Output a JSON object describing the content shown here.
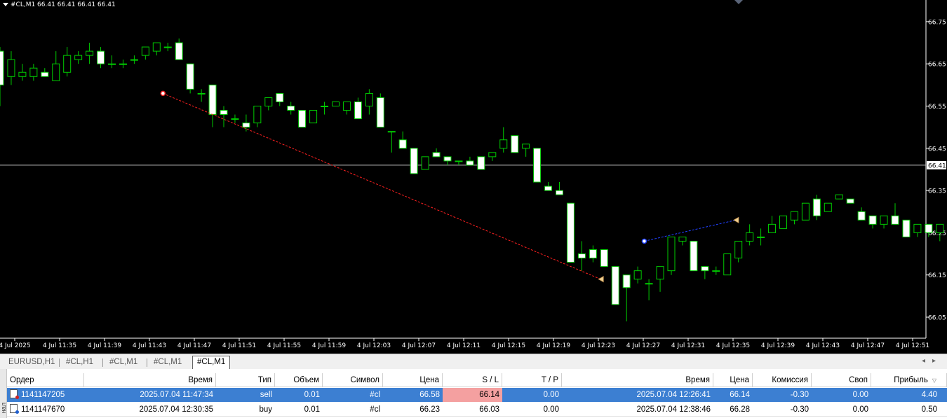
{
  "chart": {
    "header_text": "#CL,M1  66.41 66.41 66.41 66.41",
    "current_price": "66.41",
    "price_axis": [
      "66.75",
      "66.65",
      "66.55",
      "66.45",
      "66.35",
      "66.25",
      "66.15",
      "66.05"
    ],
    "time_axis": [
      "4 Jul 2025",
      "4 Jul 11:35",
      "4 Jul 11:39",
      "4 Jul 11:43",
      "4 Jul 11:47",
      "4 Jul 11:51",
      "4 Jul 11:55",
      "4 Jul 11:59",
      "4 Jul 12:03",
      "4 Jul 12:07",
      "4 Jul 12:11",
      "4 Jul 12:15",
      "4 Jul 12:19",
      "4 Jul 12:23",
      "4 Jul 12:27",
      "4 Jul 12:31",
      "4 Jul 12:35",
      "4 Jul 12:39",
      "4 Jul 12:43",
      "4 Jul 12:47",
      "4 Jul 12:51"
    ],
    "colors": {
      "background": "#000000",
      "bull": "#000000",
      "bear": "#ffffff",
      "wick": "#00cc00",
      "sell_trade_line": "#ff2020",
      "buy_trade_line": "#2040ff",
      "current_line": "#c0c0c0"
    }
  },
  "chart_data": {
    "type": "candlestick",
    "symbol": "#CL",
    "timeframe": "M1",
    "ylim": [
      66.01,
      66.8
    ],
    "candles": [
      [
        66.68,
        66.69,
        66.55,
        66.6
      ],
      [
        66.62,
        66.68,
        66.6,
        66.66
      ],
      [
        66.62,
        66.65,
        66.61,
        66.63
      ],
      [
        66.62,
        66.65,
        66.61,
        66.64
      ],
      [
        66.63,
        66.64,
        66.62,
        66.62
      ],
      [
        66.61,
        66.68,
        66.61,
        66.65
      ],
      [
        66.63,
        66.69,
        66.62,
        66.67
      ],
      [
        66.66,
        66.68,
        66.65,
        66.67
      ],
      [
        66.67,
        66.7,
        66.65,
        66.68
      ],
      [
        66.68,
        66.69,
        66.64,
        66.65
      ],
      [
        66.65,
        66.67,
        66.64,
        66.65
      ],
      [
        66.65,
        66.66,
        66.64,
        66.65
      ],
      [
        66.66,
        66.67,
        66.65,
        66.66
      ],
      [
        66.67,
        66.69,
        66.66,
        66.69
      ],
      [
        66.68,
        66.7,
        66.67,
        66.7
      ],
      [
        66.69,
        66.7,
        66.68,
        66.69
      ],
      [
        66.7,
        66.71,
        66.66,
        66.66
      ],
      [
        66.65,
        66.65,
        66.58,
        66.59
      ],
      [
        66.58,
        66.59,
        66.56,
        66.58
      ],
      [
        66.6,
        66.6,
        66.5,
        66.53
      ],
      [
        66.54,
        66.55,
        66.5,
        66.53
      ],
      [
        66.52,
        66.53,
        66.51,
        66.52
      ],
      [
        66.51,
        66.53,
        66.49,
        66.5
      ],
      [
        66.51,
        66.55,
        66.5,
        66.55
      ],
      [
        66.55,
        66.57,
        66.54,
        66.57
      ],
      [
        66.58,
        66.58,
        66.55,
        66.56
      ],
      [
        66.55,
        66.56,
        66.53,
        66.54
      ],
      [
        66.54,
        66.54,
        66.5,
        66.5
      ],
      [
        66.51,
        66.54,
        66.51,
        66.54
      ],
      [
        66.55,
        66.56,
        66.53,
        66.55
      ],
      [
        66.55,
        66.56,
        66.55,
        66.56
      ],
      [
        66.54,
        66.56,
        66.53,
        66.56
      ],
      [
        66.56,
        66.57,
        66.52,
        66.52
      ],
      [
        66.55,
        66.59,
        66.53,
        66.58
      ],
      [
        66.57,
        66.58,
        66.5,
        66.5
      ],
      [
        66.49,
        66.49,
        66.44,
        66.49
      ],
      [
        66.47,
        66.49,
        66.45,
        66.45
      ],
      [
        66.45,
        66.45,
        66.39,
        66.39
      ],
      [
        66.4,
        66.43,
        66.4,
        66.43
      ],
      [
        66.44,
        66.45,
        66.43,
        66.43
      ],
      [
        66.43,
        66.43,
        66.41,
        66.42
      ],
      [
        66.42,
        66.42,
        66.41,
        66.42
      ],
      [
        66.42,
        66.43,
        66.41,
        66.41
      ],
      [
        66.43,
        66.43,
        66.4,
        66.4
      ],
      [
        66.43,
        66.44,
        66.42,
        66.44
      ],
      [
        66.45,
        66.5,
        66.44,
        66.47
      ],
      [
        66.48,
        66.48,
        66.44,
        66.44
      ],
      [
        66.45,
        66.46,
        66.43,
        66.46
      ],
      [
        66.45,
        66.45,
        66.37,
        66.37
      ],
      [
        66.36,
        66.37,
        66.35,
        66.35
      ],
      [
        66.35,
        66.37,
        66.34,
        66.34
      ],
      [
        66.32,
        66.32,
        66.18,
        66.18
      ],
      [
        66.2,
        66.23,
        66.16,
        66.19
      ],
      [
        66.21,
        66.22,
        66.18,
        66.19
      ],
      [
        66.21,
        66.21,
        66.17,
        66.17
      ],
      [
        66.17,
        66.17,
        66.08,
        66.08
      ],
      [
        66.15,
        66.15,
        66.04,
        66.12
      ],
      [
        66.14,
        66.17,
        66.13,
        66.16
      ],
      [
        66.13,
        66.14,
        66.09,
        66.13
      ],
      [
        66.14,
        66.17,
        66.11,
        66.17
      ],
      [
        66.16,
        66.24,
        66.15,
        66.24
      ],
      [
        66.23,
        66.24,
        66.22,
        66.24
      ],
      [
        66.23,
        66.23,
        66.16,
        66.16
      ],
      [
        66.17,
        66.17,
        66.14,
        66.16
      ],
      [
        66.16,
        66.17,
        66.15,
        66.16
      ],
      [
        66.15,
        66.2,
        66.15,
        66.2
      ],
      [
        66.19,
        66.23,
        66.18,
        66.23
      ],
      [
        66.23,
        66.27,
        66.22,
        66.25
      ],
      [
        66.24,
        66.26,
        66.22,
        66.24
      ],
      [
        66.25,
        66.29,
        66.25,
        66.27
      ],
      [
        66.26,
        66.29,
        66.26,
        66.29
      ],
      [
        66.28,
        66.3,
        66.27,
        66.3
      ],
      [
        66.28,
        66.32,
        66.28,
        66.32
      ],
      [
        66.33,
        66.34,
        66.28,
        66.29
      ],
      [
        66.3,
        66.32,
        66.3,
        66.32
      ],
      [
        66.33,
        66.34,
        66.33,
        66.34
      ],
      [
        66.33,
        66.33,
        66.32,
        66.32
      ],
      [
        66.3,
        66.31,
        66.28,
        66.28
      ],
      [
        66.29,
        66.29,
        66.26,
        66.27
      ],
      [
        66.27,
        66.29,
        66.26,
        66.29
      ],
      [
        66.29,
        66.32,
        66.27,
        66.27
      ],
      [
        66.28,
        66.28,
        66.24,
        66.24
      ],
      [
        66.25,
        66.27,
        66.24,
        66.27
      ],
      [
        66.27,
        66.27,
        66.24,
        66.25
      ],
      [
        66.25,
        66.27,
        66.23,
        66.27
      ],
      [
        66.26,
        66.29,
        66.26,
        66.29
      ]
    ],
    "trades": [
      {
        "type": "sell",
        "open_time": "2025.07.04 11:47:34",
        "open_price": 66.58,
        "close_time": "2025.07.04 12:26:41",
        "close_price": 66.14
      },
      {
        "type": "buy",
        "open_time": "2025.07.04 12:30:35",
        "open_price": 66.23,
        "close_time": "2025.07.04 12:38:46",
        "close_price": 66.28
      }
    ],
    "current_price": 66.41
  },
  "tabs": [
    {
      "label": "EURUSD,H1",
      "active": false
    },
    {
      "label": "#CL,H1",
      "active": false
    },
    {
      "label": "#CL,M1",
      "active": false
    },
    {
      "label": "#CL,M1",
      "active": false
    },
    {
      "label": "#CL,M1",
      "active": true
    }
  ],
  "orders_table": {
    "side_label": "нал",
    "columns": [
      "Ордер",
      "Время",
      "Тип",
      "Объем",
      "Символ",
      "Цена",
      "S / L",
      "T / P",
      "Время",
      "Цена",
      "Комиссия",
      "Своп",
      "Прибыль"
    ],
    "rows": [
      {
        "order": "1141147205",
        "open_time": "2025.07.04 11:47:34",
        "type": "sell",
        "volume": "0.01",
        "symbol": "#cl",
        "price": "66.58",
        "sl": "66.14",
        "tp": "0.00",
        "close_time": "2025.07.04 12:26:41",
        "close_price": "66.14",
        "commission": "-0.30",
        "swap": "0.00",
        "profit": "4.40"
      },
      {
        "order": "1141147670",
        "open_time": "2025.07.04 12:30:35",
        "type": "buy",
        "volume": "0.01",
        "symbol": "#cl",
        "price": "66.23",
        "sl": "66.03",
        "tp": "0.00",
        "close_time": "2025.07.04 12:38:46",
        "close_price": "66.28",
        "commission": "-0.30",
        "swap": "0.00",
        "profit": "0.50"
      }
    ]
  }
}
